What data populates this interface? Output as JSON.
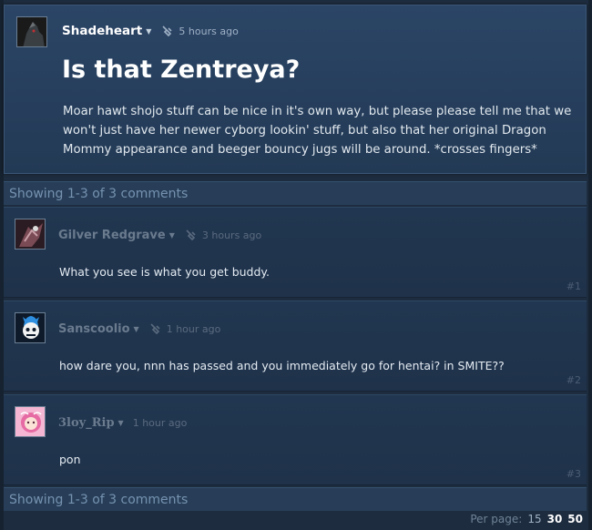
{
  "topic": {
    "author": "Shadeheart",
    "time": "5 hours ago",
    "title": "Is that Zentreya?",
    "body": "Moar hawt shojo stuff can be nice in it's own way, but please please tell me that we won't just have her newer cyborg lookin' stuff, but also that her original Dragon Mommy appearance and beeger bouncy jugs will be around. *crosses fingers*"
  },
  "showing_top": "Showing 1-3 of 3 comments",
  "comments": [
    {
      "author": "Gilver Redgrave",
      "time": "3 hours ago",
      "text": "What you see is what you get buddy.",
      "num": "#1"
    },
    {
      "author": "Sanscoolio",
      "time": "1 hour ago",
      "text": "how dare you, nnn has passed and you immediately go for hentai? in SMITE??",
      "num": "#2"
    },
    {
      "author": "3loy_Rip",
      "time": "1 hour ago",
      "text": "pon",
      "num": "#3"
    }
  ],
  "showing_bottom": "Showing 1-3 of 3 comments",
  "per_page": {
    "label": "Per page:",
    "options": [
      "15",
      "30",
      "50"
    ]
  }
}
